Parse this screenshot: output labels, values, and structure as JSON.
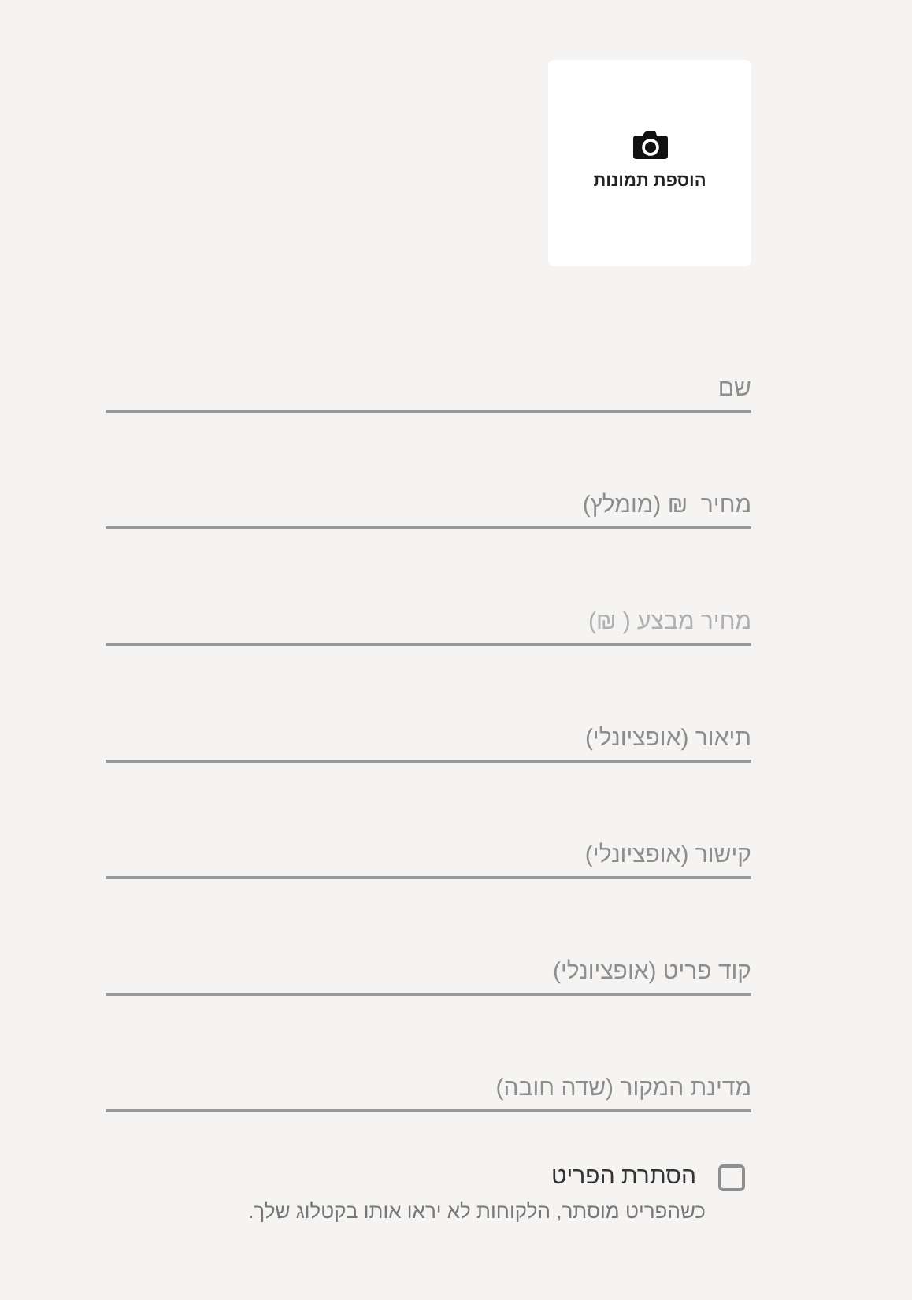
{
  "photo_upload": {
    "label": "הוספת תמונות"
  },
  "fields": [
    {
      "placeholder": "שם",
      "disabled": false
    },
    {
      "placeholder": "מחיר  ₪ (מומלץ)",
      "disabled": false
    },
    {
      "placeholder": "מחיר מבצע ( ₪)",
      "disabled": true
    },
    {
      "placeholder": "תיאור (אופציונלי)",
      "disabled": false
    },
    {
      "placeholder": "קישור (אופציונלי)",
      "disabled": false
    },
    {
      "placeholder": "קוד פריט (אופציונלי)",
      "disabled": false
    },
    {
      "placeholder": "מדינת המקור (שדה חובה)",
      "disabled": false
    }
  ],
  "hide_item": {
    "label": "הסתרת הפריט",
    "checked": false,
    "help": "כשהפריט מוסתר, הלקוחות לא יראו אותו בקטלוג שלך."
  }
}
